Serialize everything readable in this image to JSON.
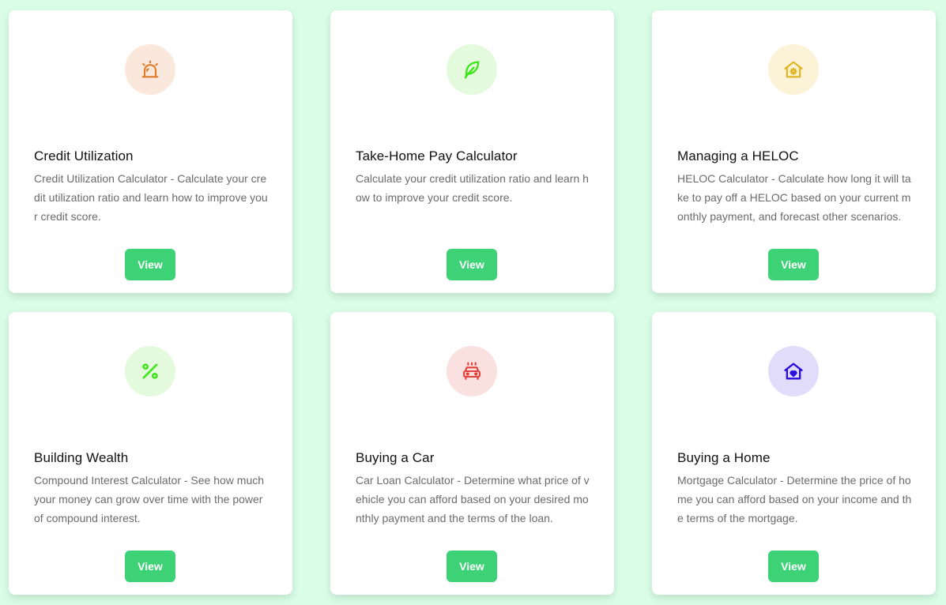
{
  "cards": [
    {
      "title": "Credit Utilization",
      "description": "Credit Utilization Calculator - Calculate your credit utilization ratio and learn how to improve your credit score.",
      "button_label": "View",
      "icon": "alarm-siren-icon",
      "icon_color": "#e07b2a",
      "icon_bg": "#fbe8dc"
    },
    {
      "title": "Take-Home Pay Calculator",
      "description": "Calculate your credit utilization ratio and learn how to improve your credit score.",
      "button_label": "View",
      "icon": "feather-icon",
      "icon_color": "#3ee51a",
      "icon_bg": "#e3fbdc"
    },
    {
      "title": "Managing a HELOC",
      "description": "HELOC Calculator - Calculate how long it will take to pay off a HELOC based on your current monthly payment, and forecast other scenarios.",
      "button_label": "View",
      "icon": "home-gear-icon",
      "icon_color": "#dfb41c",
      "icon_bg": "#fbf2d8"
    },
    {
      "title": "Building Wealth",
      "description": "Compound Interest Calculator - See how much your money can grow over time with the power of compound interest.",
      "button_label": "View",
      "icon": "percent-icon",
      "icon_color": "#3ee51a",
      "icon_bg": "#e3fbdc"
    },
    {
      "title": "Buying a Car",
      "description": "Car Loan Calculator - Determine what price of vehicle you can afford based on your desired monthly payment and the terms of the loan.",
      "button_label": "View",
      "icon": "car-icon",
      "icon_color": "#e2423c",
      "icon_bg": "#fbe0e0"
    },
    {
      "title": "Buying a Home",
      "description": "Mortgage Calculator - Determine the price of home you can afford based on your income and the terms of the mortgage.",
      "button_label": "View",
      "icon": "home-heart-icon",
      "icon_color": "#2a0ee0",
      "icon_bg": "#e2dcfb"
    }
  ]
}
